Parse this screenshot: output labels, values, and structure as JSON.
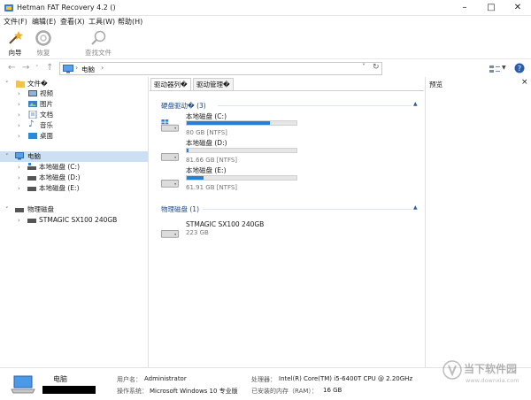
{
  "window": {
    "title": "Hetman FAT Recovery 4.2 ()"
  },
  "menu": [
    "文件(F)",
    "编辑(E)",
    "查看(X)",
    "工具(W)",
    "帮助(H)"
  ],
  "toolbar": {
    "wizard": "向导",
    "restore": "恢复",
    "find": "查找文件"
  },
  "address": {
    "location": "电脑"
  },
  "tree": {
    "files": "文件�",
    "videos": "视频",
    "pictures": "图片",
    "documents": "文档",
    "music": "音乐",
    "desktop": "桌面",
    "computer": "电脑",
    "drive_c": "本地磁盘 (C:)",
    "drive_d": "本地磁盘 (D:)",
    "drive_e": "本地磁盘 (E:)",
    "physical": "物理磁盘",
    "stmagic": "STMAGIC SX100 240GB"
  },
  "tabs": {
    "drivers_list": "驱动器列�",
    "driver_manager": "驱动管理�"
  },
  "hard_drives": {
    "header": "硬盘驱动� (3)",
    "items": [
      {
        "name": "本地磁盘 (C:)",
        "size": "80 GB [NTFS]",
        "used": 0.76
      },
      {
        "name": "本地磁盘 (D:)",
        "size": "81.66 GB [NTFS]",
        "used": 0.02
      },
      {
        "name": "本地磁盘 (E:)",
        "size": "61.91 GB [NTFS]",
        "used": 0.15
      }
    ]
  },
  "physical_disks": {
    "header": "物理磁盘 (1)",
    "items": [
      {
        "name": "STMAGIC SX100 240GB",
        "size": "223 GB"
      }
    ]
  },
  "preview": {
    "title": "预览",
    "close": "×"
  },
  "status": {
    "computer": "电脑",
    "user_label": "用户名：",
    "user": "Administrator",
    "os_label": "操作系统：",
    "os": "Microsoft Windows 10 专业版",
    "cpu_label": "处理器：",
    "cpu": "Intel(R) Core(TM) i5-6400T CPU @ 2.20GHz",
    "ram_label": "已安装的内存（RAM）：",
    "ram": "16 GB"
  },
  "watermark": {
    "title": "当下软件园",
    "url": "www.downxia.com"
  },
  "colors": {
    "accent": "#2680d6",
    "selection": "#cce0f5",
    "section": "#1c4a8a"
  }
}
